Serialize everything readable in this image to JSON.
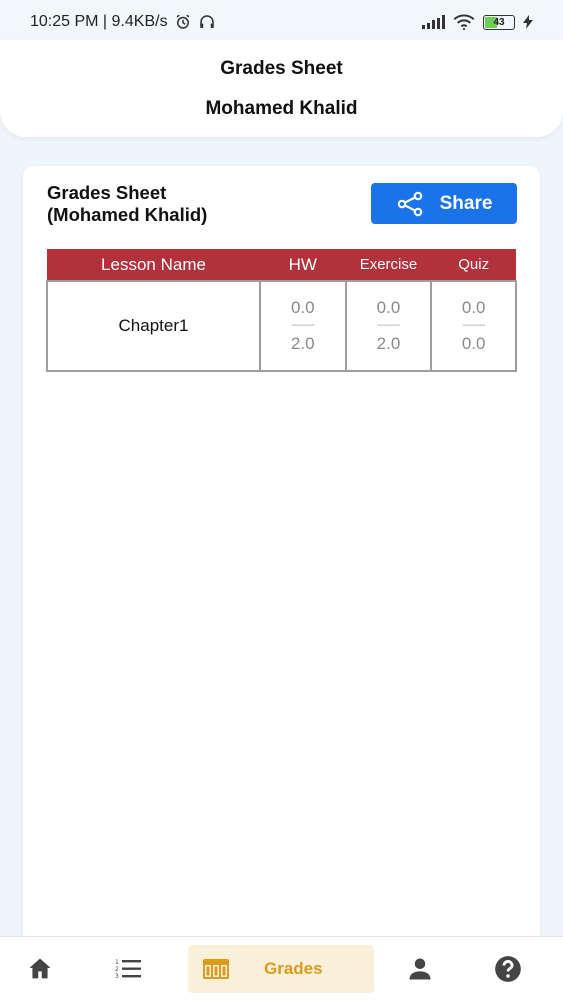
{
  "status_bar": {
    "time_speed": "10:25 PM | 9.4KB/s",
    "battery": "43"
  },
  "header": {
    "title": "Grades Sheet",
    "student_name": "Mohamed Khalid"
  },
  "sheet": {
    "title_line1": "Grades Sheet",
    "title_line2": "(Mohamed Khalid)",
    "share_label": "Share"
  },
  "table": {
    "headers": {
      "lesson": "Lesson Name",
      "hw": "HW",
      "exercise": "Exercise",
      "quiz": "Quiz"
    },
    "rows": [
      {
        "lesson": "Chapter1",
        "separator": "--------",
        "hw": {
          "score": "0.0",
          "total": "2.0"
        },
        "exercise": {
          "score": "0.0",
          "total": "2.0"
        },
        "quiz": {
          "score": "0.0",
          "total": "0.0"
        }
      }
    ]
  },
  "nav": {
    "grades_label": "Grades",
    "icons": [
      "home-icon",
      "list-icon",
      "grades-table-icon",
      "profile-icon",
      "help-icon"
    ]
  },
  "colors": {
    "accent_blue": "#1a73e8",
    "table_header": "#b2323c",
    "nav_active_bg": "#faefd8",
    "nav_active_text": "#d99b1e"
  }
}
